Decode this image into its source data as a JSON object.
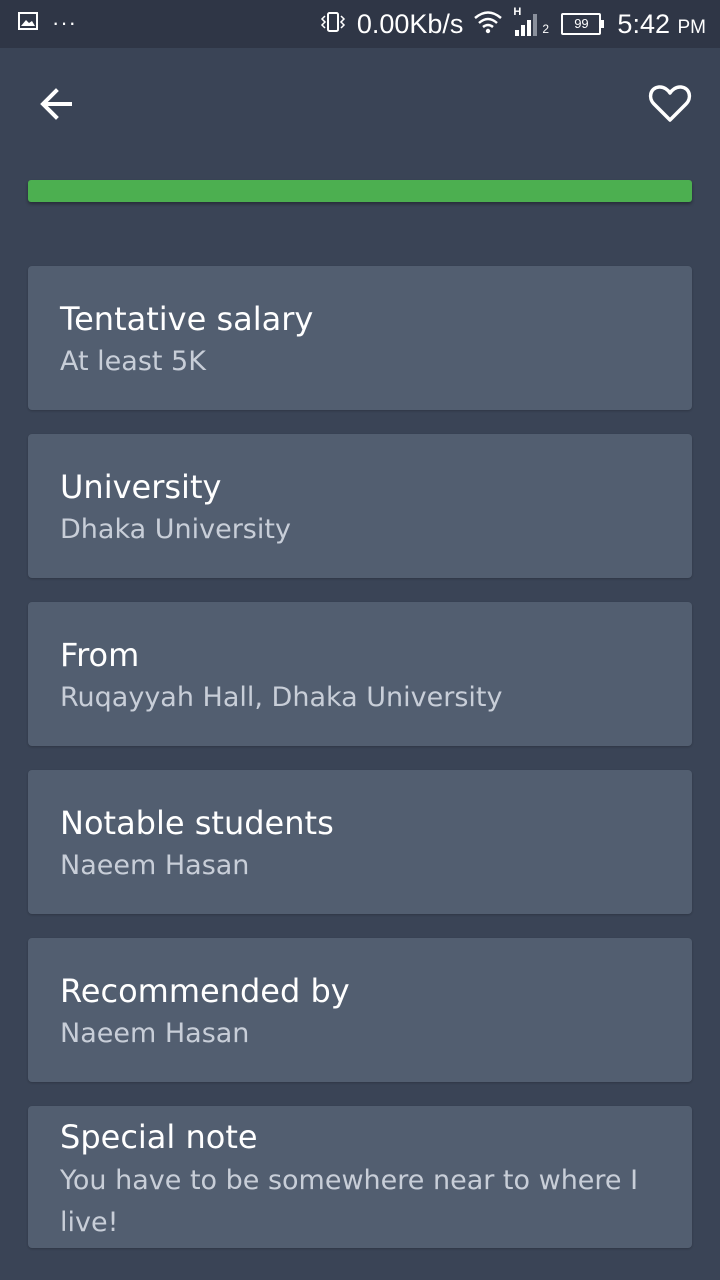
{
  "status_bar": {
    "network_speed": "0.00Kb/s",
    "network_type": "H",
    "sim_slot": "2",
    "battery": "99",
    "time": "5:42",
    "am_pm": "PM",
    "icons": [
      "image-icon",
      "more-dots-icon",
      "vibrate-icon",
      "wifi-icon",
      "signal-icon",
      "battery-icon"
    ]
  },
  "toolbar": {
    "back_icon": "arrow-left-icon",
    "favorite_icon": "heart-outline-icon"
  },
  "colors": {
    "background": "#3a4456",
    "card": "#525e70",
    "accent_bar": "#4caf50",
    "status_bar": "#2f3646"
  },
  "details": {
    "salary": {
      "title": "Tentative salary",
      "value": "At least 5K"
    },
    "university": {
      "title": "University",
      "value": "Dhaka University"
    },
    "from": {
      "title": "From",
      "value": "Ruqayyah Hall, Dhaka University"
    },
    "notable_students": {
      "title": "Notable students",
      "value": "Naeem Hasan"
    },
    "recommended_by": {
      "title": "Recommended by",
      "value": "Naeem Hasan"
    },
    "special_note": {
      "title": "Special note",
      "value": "You have to be somewhere near to where I live!"
    }
  }
}
